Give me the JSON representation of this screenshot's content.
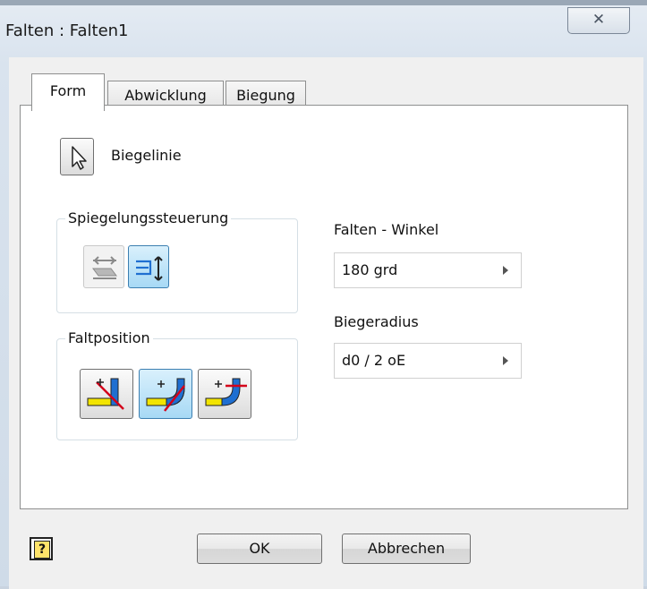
{
  "window": {
    "title": "Falten : Falten1",
    "close_glyph": "✕"
  },
  "tabs": [
    {
      "label": "Form",
      "active": true
    },
    {
      "label": "Abwicklung",
      "active": false
    },
    {
      "label": "Biegung",
      "active": false
    }
  ],
  "form": {
    "biegelinie_label": "Biegelinie",
    "spiegelung_title": "Spiegelungssteuerung",
    "faltposition_title": "Faltposition",
    "winkel_label": "Falten - Winkel",
    "winkel_value": "180 grd",
    "radius_label": "Biegeradius",
    "radius_value": "d0 / 2 oE"
  },
  "buttons": {
    "ok": "OK",
    "cancel": "Abbrechen",
    "help": "?"
  },
  "colors": {
    "accent_blue": "#1f6fd1",
    "yellow": "#f2e400",
    "red": "#d4001a",
    "pressed_bg": "#b9e2f8"
  },
  "icons": {
    "select": "cursor-arrow-icon",
    "mirror_1": "flip-horizontal-icon",
    "mirror_2": "flip-vertical-icon",
    "fold_1": "fold-start-icon",
    "fold_2": "fold-centerline-icon",
    "fold_3": "fold-end-icon"
  }
}
